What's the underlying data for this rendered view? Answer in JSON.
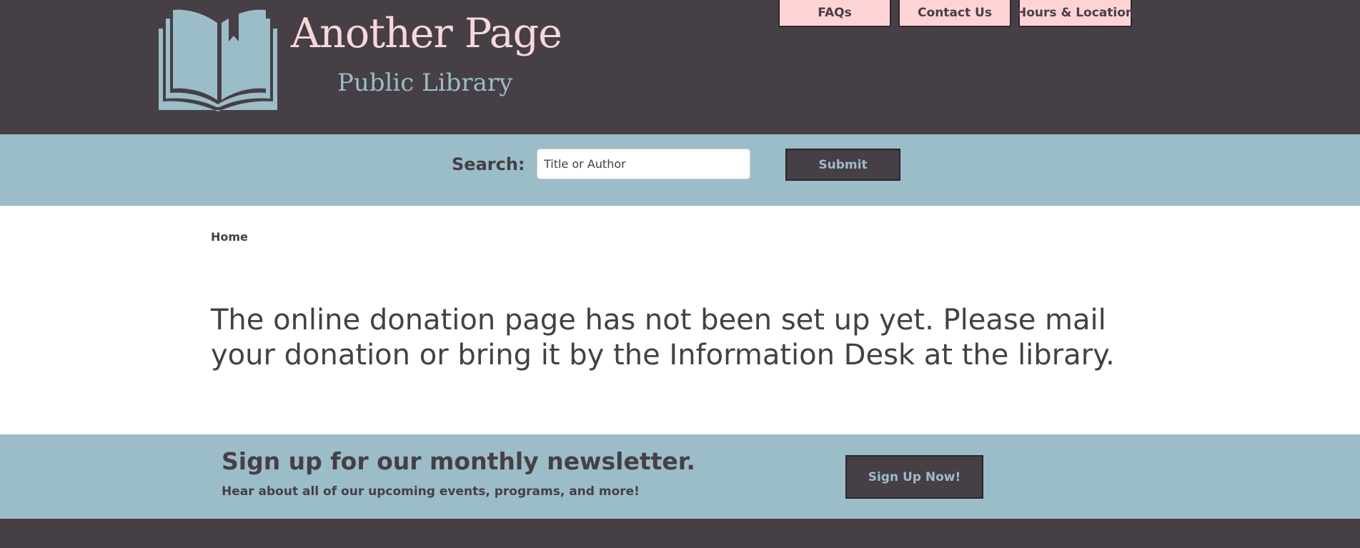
{
  "header": {
    "title": "Another Page",
    "subtitle": "Public Library",
    "logo_icon": "open-book-icon",
    "nav": [
      {
        "label": "FAQs"
      },
      {
        "label": "Contact Us"
      },
      {
        "label": "Hours & Location"
      }
    ]
  },
  "search": {
    "label": "Search:",
    "placeholder": "Title or Author",
    "submit_label": "Submit"
  },
  "breadcrumb": {
    "home": "Home"
  },
  "main": {
    "message": "The online donation page has not been set up yet. Please mail your donation or bring it by the Information Desk at the library."
  },
  "newsletter": {
    "title": "Sign up for our monthly newsletter.",
    "subtitle": "Hear about all of our upcoming events, programs, and more!",
    "button_label": "Sign Up Now!"
  },
  "colors": {
    "dark": "#463f45",
    "pink": "#fdd3d6",
    "blue": "#9bbdc7",
    "white": "#ffffff"
  }
}
